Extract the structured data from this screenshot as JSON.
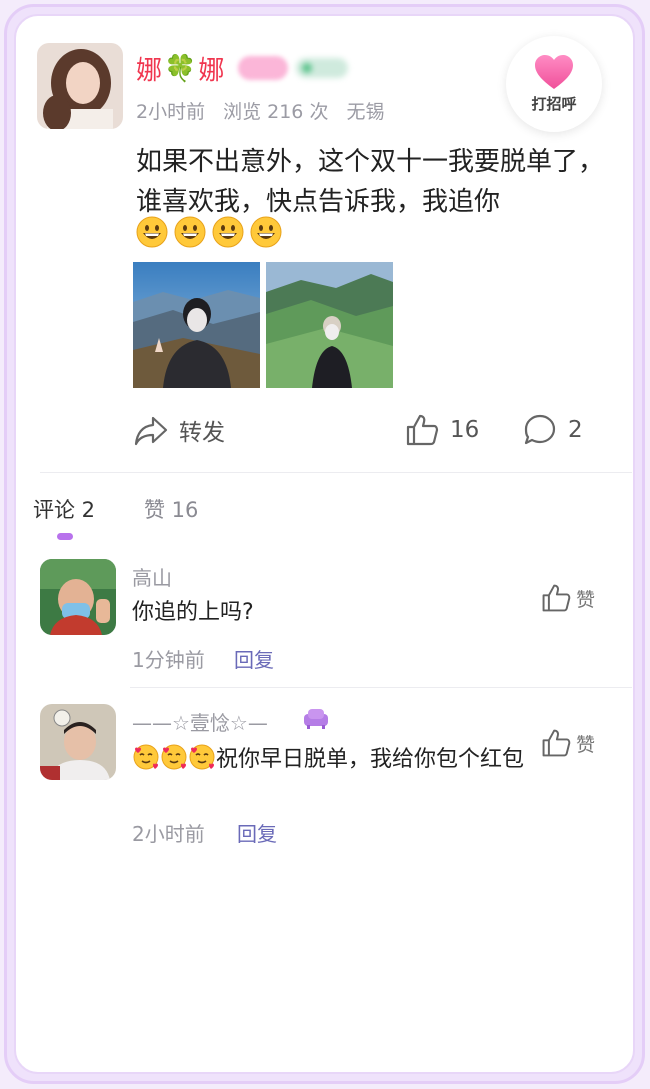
{
  "post": {
    "author": {
      "name_part1": "娜",
      "name_part2": "娜",
      "clover": "🍀"
    },
    "time": "2小时前",
    "views": "浏览 216 次",
    "location": "无锡",
    "greet_label": "打招呼",
    "text": "如果不出意外，这个双十一我要脱单了，谁喜欢我，快点告诉我，我追你",
    "emojis": [
      "grinning-face",
      "grinning-face",
      "grinning-face",
      "grinning-face"
    ],
    "photos": [
      "mountain-photo-1",
      "mountain-photo-2"
    ],
    "actions": {
      "forward_label": "转发",
      "likes": "16",
      "comments": "2"
    }
  },
  "tabs": {
    "comments": "评论 2",
    "likes": "赞 16"
  },
  "comments": [
    {
      "name": "高山",
      "text": "你追的上吗?",
      "time": "1分钟前",
      "reply_label": "回复",
      "like_label": "赞"
    },
    {
      "name": "——☆壹惗☆—",
      "text_rest": "祝你早日脱单，我给你包个红包",
      "emojis": [
        "face-with-hearts",
        "face-with-hearts",
        "face-with-hearts"
      ],
      "time": "2小时前",
      "reply_label": "回复",
      "like_label": "赞"
    }
  ],
  "colors": {
    "accent": "#b872ec",
    "name_red": "#f0364f",
    "heart_pink": "#f56aa8",
    "reply_link": "#6a6ab8"
  }
}
